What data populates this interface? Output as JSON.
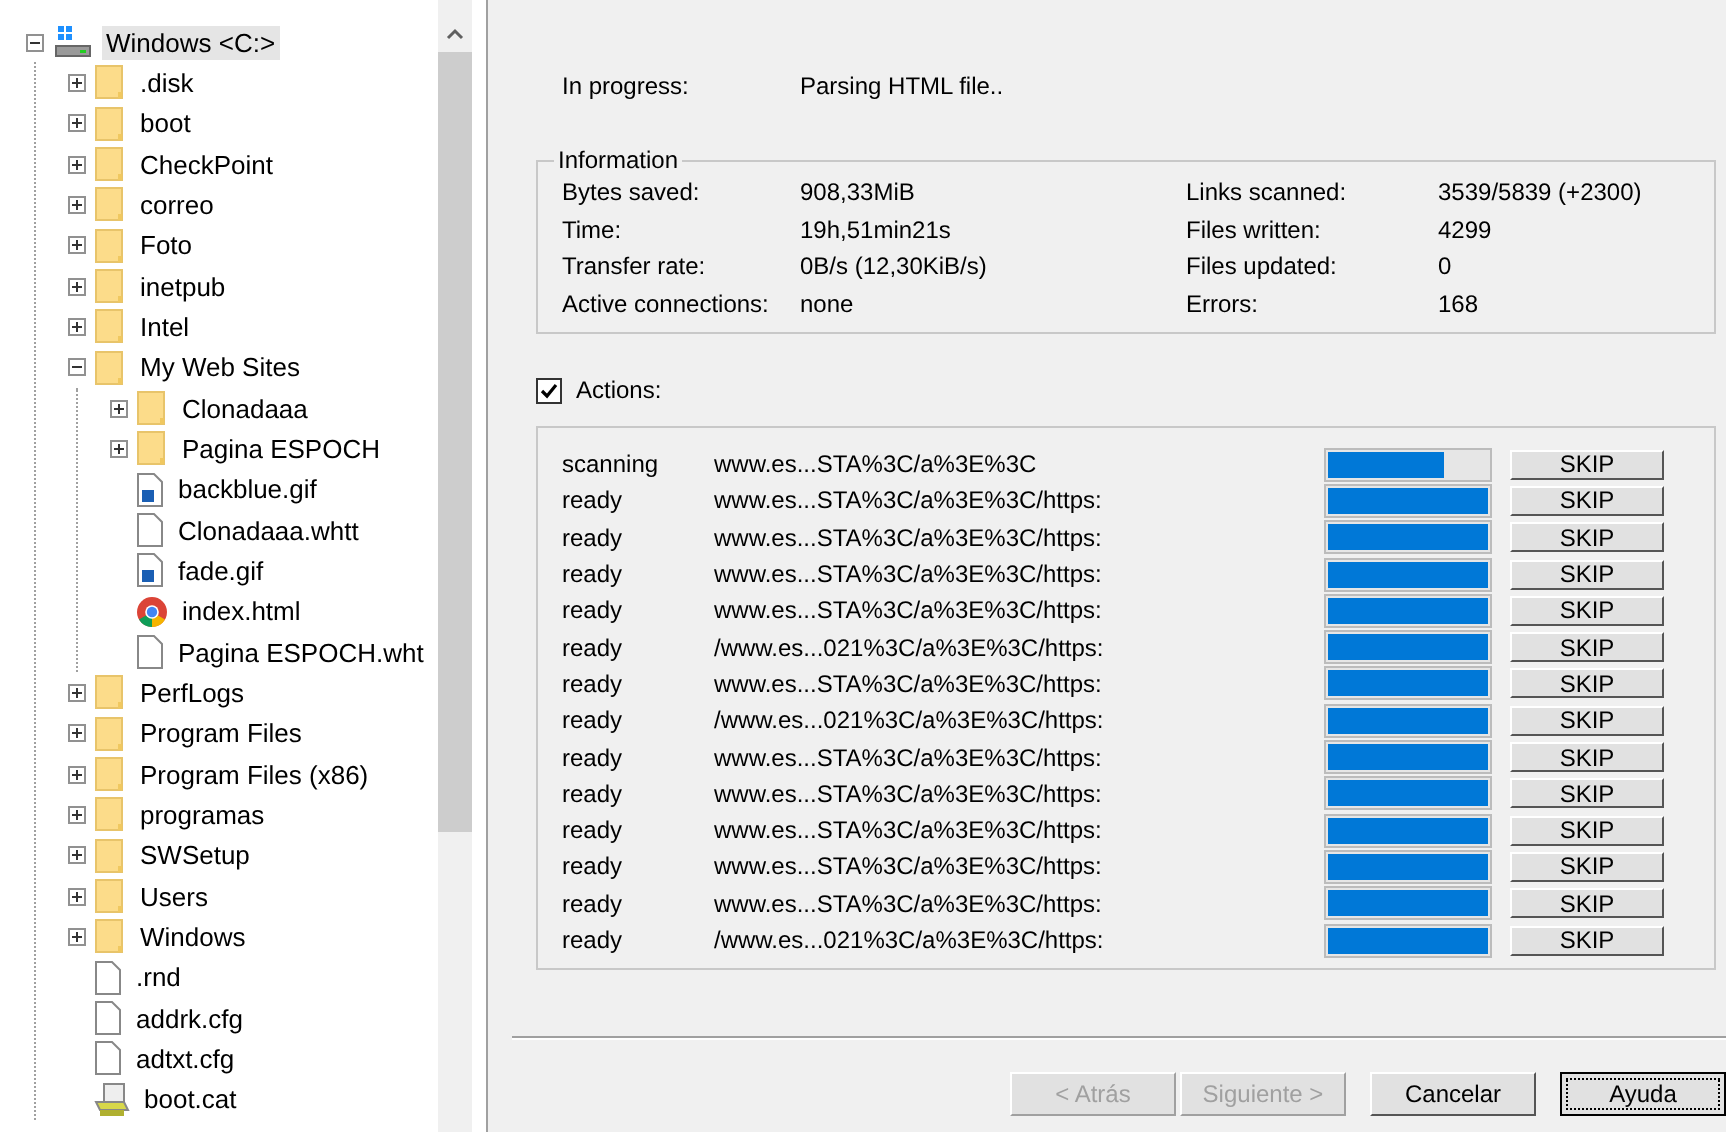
{
  "tree": {
    "label": "Windows <C:>",
    "kind": "drive",
    "expanded": true,
    "selected": true,
    "children": [
      {
        "label": ".disk",
        "kind": "folder",
        "expanded": false,
        "selected": false
      },
      {
        "label": "boot",
        "kind": "folder",
        "expanded": false,
        "selected": false
      },
      {
        "label": "CheckPoint",
        "kind": "folder",
        "expanded": false,
        "selected": false
      },
      {
        "label": "correo",
        "kind": "folder",
        "expanded": false,
        "selected": false
      },
      {
        "label": "Foto",
        "kind": "folder",
        "expanded": false,
        "selected": false
      },
      {
        "label": "inetpub",
        "kind": "folder",
        "expanded": false,
        "selected": false
      },
      {
        "label": "Intel",
        "kind": "folder",
        "expanded": false,
        "selected": false
      },
      {
        "label": "My Web Sites",
        "kind": "folder",
        "expanded": true,
        "selected": false,
        "children": [
          {
            "label": "Clonadaaa",
            "kind": "folder",
            "expanded": false,
            "selected": false
          },
          {
            "label": "Pagina ESPOCH",
            "kind": "folder",
            "expanded": false,
            "selected": false
          },
          {
            "label": "backblue.gif",
            "kind": "image",
            "selected": false
          },
          {
            "label": "Clonadaaa.whtt",
            "kind": "file",
            "selected": false
          },
          {
            "label": "fade.gif",
            "kind": "image",
            "selected": false
          },
          {
            "label": "index.html",
            "kind": "browser",
            "selected": false
          },
          {
            "label": "Pagina ESPOCH.wht",
            "kind": "file",
            "selected": false
          }
        ]
      },
      {
        "label": "PerfLogs",
        "kind": "folder",
        "expanded": false,
        "selected": false
      },
      {
        "label": "Program Files",
        "kind": "folder",
        "expanded": false,
        "selected": false
      },
      {
        "label": "Program Files (x86)",
        "kind": "folder",
        "expanded": false,
        "selected": false
      },
      {
        "label": "programas",
        "kind": "folder",
        "expanded": false,
        "selected": false
      },
      {
        "label": "SWSetup",
        "kind": "folder",
        "expanded": false,
        "selected": false
      },
      {
        "label": "Users",
        "kind": "folder",
        "expanded": false,
        "selected": false
      },
      {
        "label": "Windows",
        "kind": "folder",
        "expanded": false,
        "selected": false
      },
      {
        "label": ".rnd",
        "kind": "file",
        "selected": false
      },
      {
        "label": "addrk.cfg",
        "kind": "file",
        "selected": false
      },
      {
        "label": "adtxt.cfg",
        "kind": "file",
        "selected": false
      },
      {
        "label": "boot.cat",
        "kind": "catalog",
        "selected": false
      }
    ]
  },
  "progress": {
    "label": "In progress:",
    "value": "Parsing HTML file.."
  },
  "information": {
    "title": "Information",
    "left": [
      {
        "label": "Bytes saved:",
        "value": "908,33MiB"
      },
      {
        "label": "Time:",
        "value": "19h,51min21s"
      },
      {
        "label": "Transfer rate:",
        "value": "0B/s (12,30KiB/s)"
      },
      {
        "label": "Active connections:",
        "value": "none"
      }
    ],
    "right": [
      {
        "label": "Links scanned:",
        "value": "3539/5839 (+2300)"
      },
      {
        "label": "Files written:",
        "value": "4299"
      },
      {
        "label": "Files updated:",
        "value": "0"
      },
      {
        "label": "Errors:",
        "value": "168"
      }
    ]
  },
  "actions_toggle": {
    "label": "Actions:",
    "checked": true
  },
  "actions": [
    {
      "status": "scanning",
      "url": "www.es...STA%3C/a%3E%3C",
      "level": 0.73,
      "button": "SKIP"
    },
    {
      "status": "ready",
      "url": "www.es...STA%3C/a%3E%3C/https:",
      "level": 1,
      "button": "SKIP"
    },
    {
      "status": "ready",
      "url": "www.es...STA%3C/a%3E%3C/https:",
      "level": 1,
      "button": "SKIP"
    },
    {
      "status": "ready",
      "url": "www.es...STA%3C/a%3E%3C/https:",
      "level": 1,
      "button": "SKIP"
    },
    {
      "status": "ready",
      "url": "www.es...STA%3C/a%3E%3C/https:",
      "level": 1,
      "button": "SKIP"
    },
    {
      "status": "ready",
      "url": "/www.es...021%3C/a%3E%3C/https:",
      "level": 1,
      "button": "SKIP"
    },
    {
      "status": "ready",
      "url": "www.es...STA%3C/a%3E%3C/https:",
      "level": 1,
      "button": "SKIP"
    },
    {
      "status": "ready",
      "url": "/www.es...021%3C/a%3E%3C/https:",
      "level": 1,
      "button": "SKIP"
    },
    {
      "status": "ready",
      "url": "www.es...STA%3C/a%3E%3C/https:",
      "level": 1,
      "button": "SKIP"
    },
    {
      "status": "ready",
      "url": "www.es...STA%3C/a%3E%3C/https:",
      "level": 1,
      "button": "SKIP"
    },
    {
      "status": "ready",
      "url": "www.es...STA%3C/a%3E%3C/https:",
      "level": 1,
      "button": "SKIP"
    },
    {
      "status": "ready",
      "url": "www.es...STA%3C/a%3E%3C/https:",
      "level": 1,
      "button": "SKIP"
    },
    {
      "status": "ready",
      "url": "www.es...STA%3C/a%3E%3C/https:",
      "level": 1,
      "button": "SKIP"
    },
    {
      "status": "ready",
      "url": "/www.es...021%3C/a%3E%3C/https:",
      "level": 1,
      "button": "SKIP"
    }
  ],
  "buttons": [
    {
      "label": "< Atrás",
      "disabled": true,
      "focused": false
    },
    {
      "label": "Siguiente >",
      "disabled": true,
      "focused": false
    },
    {
      "label": "Cancelar",
      "disabled": false,
      "focused": false
    },
    {
      "label": "Ayuda",
      "disabled": false,
      "focused": true
    }
  ]
}
